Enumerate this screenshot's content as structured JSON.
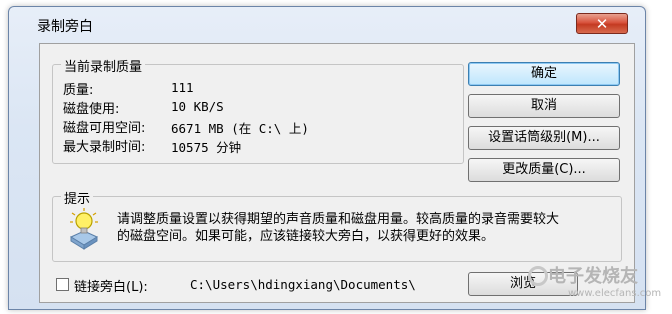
{
  "window": {
    "title": "录制旁白",
    "close_glyph": "✕"
  },
  "quality_group": {
    "title": "当前录制质量",
    "rows": [
      {
        "label": "质量:",
        "value": "111"
      },
      {
        "label": "磁盘使用:",
        "value": "10 KB/S"
      },
      {
        "label": "磁盘可用空间:",
        "value": "6671 MB (在 C:\\ 上)"
      },
      {
        "label": "最大录制时间:",
        "value": "10575 分钟"
      }
    ]
  },
  "buttons": {
    "ok": "确定",
    "cancel": "取消",
    "mic_level": "设置话筒级别(M)...",
    "change_quality": "更改质量(C)...",
    "browse": "浏览"
  },
  "hint_group": {
    "title": "提示",
    "text": "请调整质量设置以获得期望的声音质量和磁盘用量。较高质量的录音需要较大的磁盘空间。如果可能，应该链接较大旁白，以获得更好的效果。"
  },
  "link": {
    "checkbox_label": "链接旁白(L):",
    "checked": false,
    "path": "C:\\Users\\hdingxiang\\Documents\\"
  },
  "watermark": {
    "text": "电子发烧友",
    "sub": "www.elecfans.com"
  },
  "colors": {
    "accent": "#3c7fb1",
    "close": "#c43a21"
  }
}
